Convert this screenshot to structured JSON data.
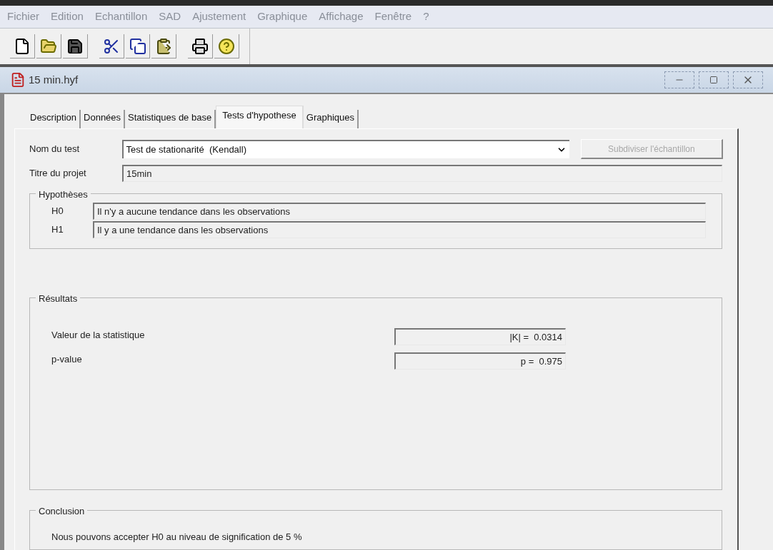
{
  "menu": [
    {
      "label": "Fichier"
    },
    {
      "label": "Edition"
    },
    {
      "label": "Echantillon"
    },
    {
      "label": "SAD"
    },
    {
      "label": "Ajustement"
    },
    {
      "label": "Graphique"
    },
    {
      "label": "Affichage"
    },
    {
      "label": "Fenêtre"
    },
    {
      "label": "?"
    }
  ],
  "toolbar": [
    {
      "kind": "new"
    },
    {
      "kind": "open"
    },
    {
      "kind": "save"
    },
    {
      "kind": "sep"
    },
    {
      "kind": "cut"
    },
    {
      "kind": "copy"
    },
    {
      "kind": "paste"
    },
    {
      "kind": "sep"
    },
    {
      "kind": "print"
    },
    {
      "kind": "help"
    }
  ],
  "window": {
    "title": "15 min.hyf"
  },
  "tabs": [
    {
      "label": "Description",
      "selected": false
    },
    {
      "label": "Données",
      "selected": false
    },
    {
      "label": "Statistiques de base",
      "selected": false
    },
    {
      "label": "Tests d'hypothese",
      "selected": true
    },
    {
      "label": "Graphiques",
      "selected": false
    }
  ],
  "test": {
    "label": "Nom du test",
    "value": "Test de stationarité  (Kendall)",
    "button": {
      "label": "Subdiviser l'échantillon",
      "disabled": true
    }
  },
  "project": {
    "label": "Titre du projet",
    "value": "15min"
  },
  "hypotheses": {
    "title": "Hypothèses",
    "items": [
      {
        "label": "H0",
        "value": "Il n'y a aucune tendance dans les observations"
      },
      {
        "label": "H1",
        "value": "Il y a une tendance dans les observations"
      }
    ]
  },
  "results": {
    "title": "Résultats",
    "items": [
      {
        "label": "Valeur de la statistique",
        "value": "|K| =  0.0314"
      },
      {
        "label": "p-value",
        "value": "p =  0.975"
      }
    ]
  },
  "conclusion": {
    "title": "Conclusion",
    "text": "Nous pouvons accepter H0 au niveau de signification de 5 %"
  }
}
